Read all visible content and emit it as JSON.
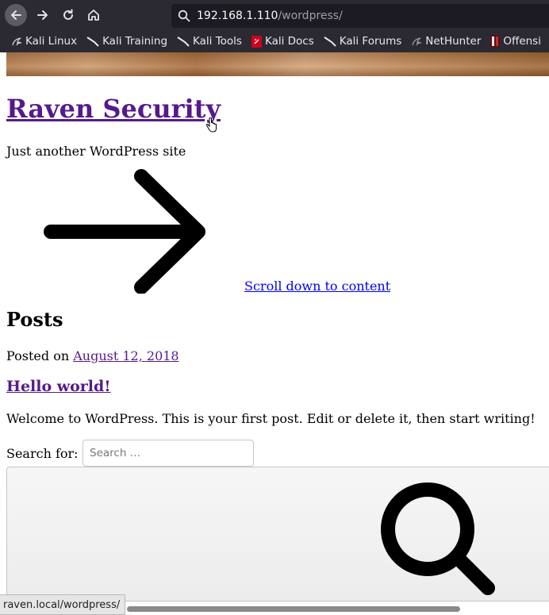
{
  "browser": {
    "url_host": "192.168.1.110",
    "url_path": "/wordpress/",
    "bookmarks": [
      {
        "label": "Kali Linux",
        "icon": "kali-dragon-icon"
      },
      {
        "label": "Kali Training",
        "icon": "kali-dragon-icon"
      },
      {
        "label": "Kali Tools",
        "icon": "kali-dragon-icon"
      },
      {
        "label": "Kali Docs",
        "icon": "kali-docs-icon"
      },
      {
        "label": "Kali Forums",
        "icon": "kali-dragon-icon"
      },
      {
        "label": "NetHunter",
        "icon": "nethunter-icon"
      },
      {
        "label": "Offensi",
        "icon": "offensive-security-icon"
      }
    ]
  },
  "site": {
    "title": "Raven Security",
    "tagline": "Just another WordPress site",
    "scroll_link": "Scroll down to content"
  },
  "posts": {
    "heading": "Posts",
    "posted_on_label": "Posted on",
    "date": "August 12, 2018",
    "title": "Hello world!",
    "excerpt": "Welcome to WordPress. This is your first post. Edit or delete it, then start writing!"
  },
  "search": {
    "label": "Search for:",
    "placeholder": "Search …"
  },
  "status": {
    "link_preview": "raven.local/wordpress/"
  },
  "colors": {
    "chrome_bg": "#2b2a33",
    "urlbar_bg": "#1c1b22",
    "visited_link": "#551a8b",
    "link": "#0000ee"
  }
}
